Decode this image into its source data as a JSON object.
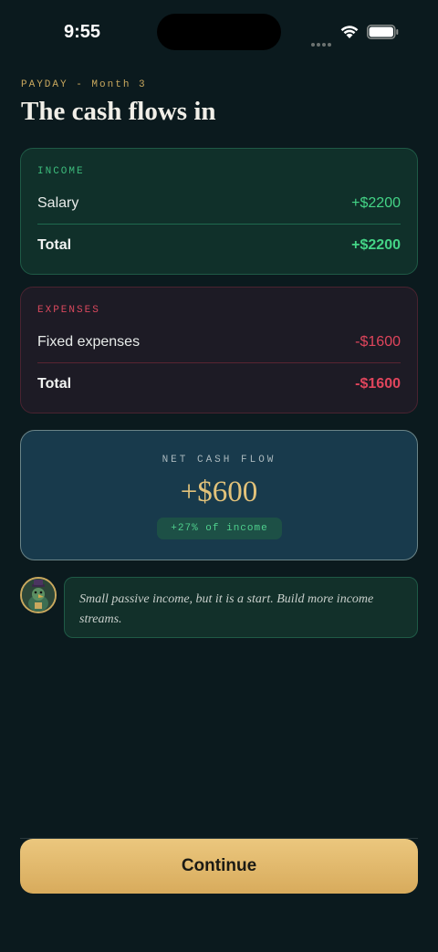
{
  "status_bar": {
    "time": "9:55"
  },
  "header": {
    "eyebrow": "PAYDAY - Month 3",
    "title": "The cash flows in"
  },
  "income": {
    "label": "INCOME",
    "rows": [
      {
        "label": "Salary",
        "value": "+$2200"
      }
    ],
    "total_label": "Total",
    "total_value": "+$2200",
    "accent": "#44d486"
  },
  "expenses": {
    "label": "EXPENSES",
    "rows": [
      {
        "label": "Fixed expenses",
        "value": "-$1600"
      }
    ],
    "total_label": "Total",
    "total_value": "-$1600",
    "accent": "#e0455c"
  },
  "net": {
    "label": "NET CASH FLOW",
    "value": "+$600",
    "badge": "+27% of income"
  },
  "advisor": {
    "avatar_icon": "advisor-avatar",
    "message": "Small passive income, but it is a start. Build more income streams."
  },
  "footer": {
    "continue_label": "Continue"
  },
  "colors": {
    "background": "#0b1a1e",
    "gold": "#c9a85e",
    "button": "#e6c075"
  }
}
